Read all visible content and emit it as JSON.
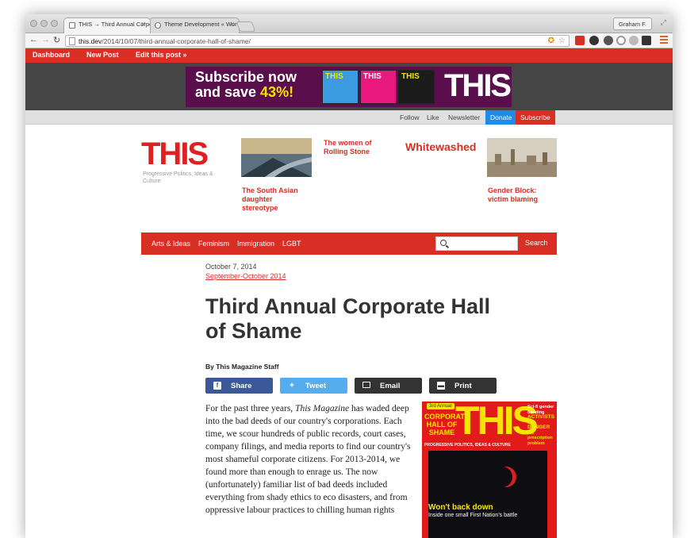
{
  "browser": {
    "tabs": [
      {
        "title": "THIS → Third Annual Corpo",
        "active": true
      },
      {
        "title": "Theme Development « Wor",
        "active": false
      }
    ],
    "user": "Graham F.",
    "url": "this.dev/2014/10/07/third-annual-corporate-hall-of-shame/",
    "url_host": "this.dev",
    "url_path": "/2014/10/07/third-annual-corporate-hall-of-shame/"
  },
  "adminbar": {
    "dashboard": "Dashboard",
    "new_post": "New Post",
    "edit_post": "Edit this post »"
  },
  "banner": {
    "line1": "Subscribe now",
    "line2_prefix": "and save ",
    "line2_highlight": "43%!",
    "logo": "THIS"
  },
  "social": {
    "follow": "Follow",
    "like": "Like",
    "newsletter": "Newsletter",
    "donate": "Donate",
    "subscribe": "Subscribe"
  },
  "site": {
    "logo": "THIS",
    "tagline": "Progressive Politics, Ideas & Culture"
  },
  "featured": [
    {
      "headline": "The South Asian daughter stereotype"
    },
    {
      "headline": "The women of Rolling Stone"
    },
    {
      "headline": "Whitewashed"
    },
    {
      "headline": "Gender Block: victim blaming"
    }
  ],
  "nav": {
    "items": [
      "Arts & Ideas",
      "Feminism",
      "Immigration",
      "LGBT"
    ],
    "search_button": "Search",
    "search_value": ""
  },
  "article": {
    "date": "October 7, 2014",
    "issue": "September-October 2014",
    "title": "Third Annual Corporate Hall of Shame",
    "byline": "By This Magazine Staff",
    "share": {
      "facebook": "Share",
      "twitter": "Tweet",
      "email": "Email",
      "print": "Print"
    },
    "body_part1": "For the past three years, ",
    "body_italic": "This Magazine",
    "body_part2": " has waded deep into the bad deeds of our country's corporations. Each time, we scour hundreds of public records, court cases, company filings, and media reports to find our country's most shameful corporate citizens. For 2013-2014, we found more than enough to enrage us. The now (unfortunately) familiar list of bad deeds included everything from shady ethics to eco disasters, and from oppressive labour practices to chilling human rights"
  },
  "cover": {
    "logo": "THIS",
    "badge": "3rd Annual",
    "hall": "CORPORATE HALL OF SHAME",
    "subtitle": "PROGRESSIVE POLITICS, IDEAS & CULTURE",
    "side1": "Sci-fi gender bending",
    "side2": "ACTIVISTS IN DANGER",
    "side3": "the prescription problem",
    "headline": "Won't back down",
    "subhead": "Inside one small First Nation's battle"
  },
  "colors": {
    "brand_red": "#d82e23",
    "donate_blue": "#1e8be8",
    "facebook": "#3b5998",
    "twitter": "#55acee",
    "email": "#333333",
    "print": "#333333"
  }
}
